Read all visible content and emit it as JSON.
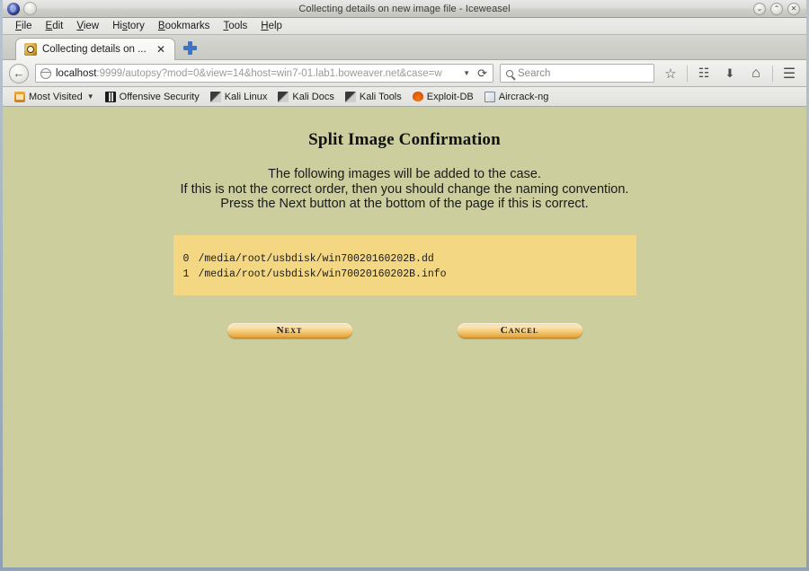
{
  "window": {
    "title": "Collecting details on new image file - Iceweasel",
    "controls": [
      {
        "name": "minimize",
        "glyph": "⌄"
      },
      {
        "name": "maximize",
        "glyph": "⌃"
      },
      {
        "name": "close",
        "glyph": "✕"
      }
    ]
  },
  "menubar": {
    "items": [
      {
        "pre": "",
        "key": "F",
        "post": "ile"
      },
      {
        "pre": "",
        "key": "E",
        "post": "dit"
      },
      {
        "pre": "",
        "key": "V",
        "post": "iew"
      },
      {
        "pre": "Hi",
        "key": "s",
        "post": "tory"
      },
      {
        "pre": "",
        "key": "B",
        "post": "ookmarks"
      },
      {
        "pre": "",
        "key": "T",
        "post": "ools"
      },
      {
        "pre": "",
        "key": "H",
        "post": "elp"
      }
    ]
  },
  "tabs": {
    "active": {
      "label": "Collecting details on ...",
      "close_glyph": "✕"
    }
  },
  "navbar": {
    "back_glyph": "←",
    "url_host": "localhost",
    "url_rest": ":9999/autopsy?mod=0&view=14&host=win7-01.lab1.boweaver.net&case=w",
    "url_dropdown_glyph": "▼",
    "reload_glyph": "⟳",
    "search_placeholder": "Search",
    "bookmark_glyph": "☆",
    "library_glyph": "☷",
    "download_glyph": "⬇",
    "home_glyph": "⌂",
    "menu_glyph": "☰"
  },
  "bookmarks": {
    "items": [
      {
        "label": "Most Visited",
        "icon": "folder-icon",
        "has_caret": true
      },
      {
        "label": "Offensive Security",
        "icon": "dragon-icon",
        "has_caret": false
      },
      {
        "label": "Kali Linux",
        "icon": "wrench-icon",
        "has_caret": false
      },
      {
        "label": "Kali Docs",
        "icon": "wrench-icon",
        "has_caret": false
      },
      {
        "label": "Kali Tools",
        "icon": "wrench-icon",
        "has_caret": false
      },
      {
        "label": "Exploit-DB",
        "icon": "flame-icon",
        "has_caret": false
      },
      {
        "label": "Aircrack-ng",
        "icon": "page-icon",
        "has_caret": false
      }
    ]
  },
  "page": {
    "title": "Split Image Confirmation",
    "paragraph_lines": [
      "The following images will be added to the case.",
      "If this is not the correct order, then you should change the naming convention.",
      "Press the Next button at the bottom of the page if this is correct."
    ],
    "files": [
      {
        "index": "0",
        "path": "/media/root/usbdisk/win70020160202B.dd"
      },
      {
        "index": "1",
        "path": "/media/root/usbdisk/win70020160202B.info"
      }
    ],
    "buttons": {
      "next": "Next",
      "cancel": "Cancel"
    },
    "colors": {
      "page_background": "#ccce9d",
      "filelist_background": "#f4d782",
      "button_accent": "#eaae4a"
    }
  }
}
